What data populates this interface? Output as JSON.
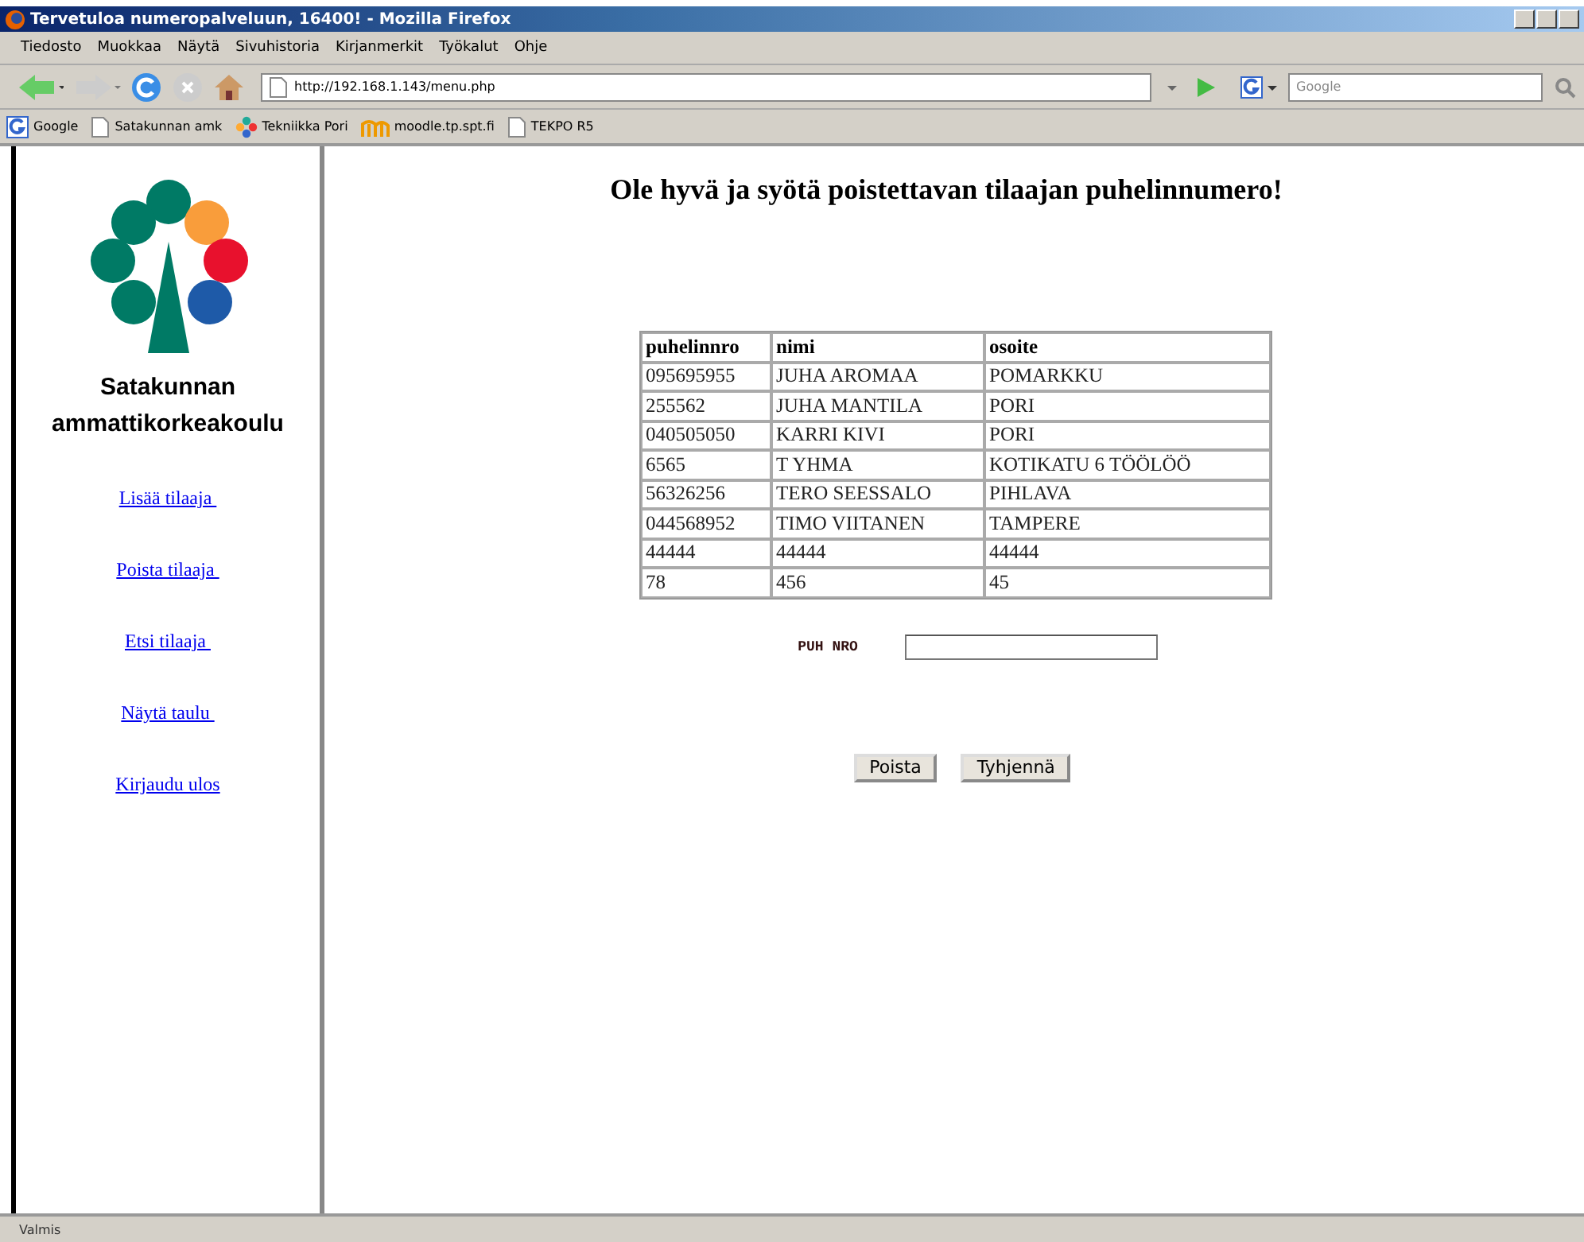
{
  "window": {
    "title": "Tervetuloa numeropalveluun, 16400! - Mozilla Firefox"
  },
  "menu": [
    "Tiedosto",
    "Muokkaa",
    "Näytä",
    "Sivuhistoria",
    "Kirjanmerkit",
    "Työkalut",
    "Ohje"
  ],
  "address": {
    "value": "http://192.168.1.143/menu.php"
  },
  "search": {
    "placeholder": "Google"
  },
  "bookmarks": [
    {
      "label": "Google",
      "kind": "google"
    },
    {
      "label": "Satakunnan amk",
      "kind": "page"
    },
    {
      "label": "Tekniikka Pori",
      "kind": "flower"
    },
    {
      "label": "moodle.tp.spt.fi",
      "kind": "moodle"
    },
    {
      "label": "TEKPO R5",
      "kind": "page"
    }
  ],
  "sidebar": {
    "logo_lines": [
      "Satakunnan",
      "ammattikorkeakoulu"
    ],
    "links": [
      "Lisää tilaaja ",
      "Poista tilaaja ",
      "Etsi tilaaja ",
      "Näytä taulu ",
      "Kirjaudu ulos"
    ]
  },
  "main": {
    "heading": "Ole hyvä ja syötä poistettavan tilaajan puhelinnumero!",
    "table": {
      "columns": [
        "puhelinnro",
        "nimi",
        "osoite"
      ],
      "rows": [
        [
          "095695955",
          "JUHA AROMAA",
          "POMARKKU"
        ],
        [
          "255562",
          "JUHA MANTILA",
          "PORI"
        ],
        [
          "040505050",
          "KARRI KIVI",
          "PORI"
        ],
        [
          "6565",
          "T YHMA",
          "KOTIKATU 6 TÖÖLÖÖ"
        ],
        [
          "56326256",
          "TERO SEESSALO",
          "PIHLAVA"
        ],
        [
          "044568952",
          "TIMO VIITANEN",
          "TAMPERE"
        ],
        [
          "44444",
          "44444",
          "44444"
        ],
        [
          "78",
          "456",
          "45"
        ]
      ]
    },
    "form": {
      "label": "PUH NRO"
    },
    "buttons": [
      "Poista",
      "Tyhjennä"
    ]
  },
  "status_bar": "Valmis"
}
